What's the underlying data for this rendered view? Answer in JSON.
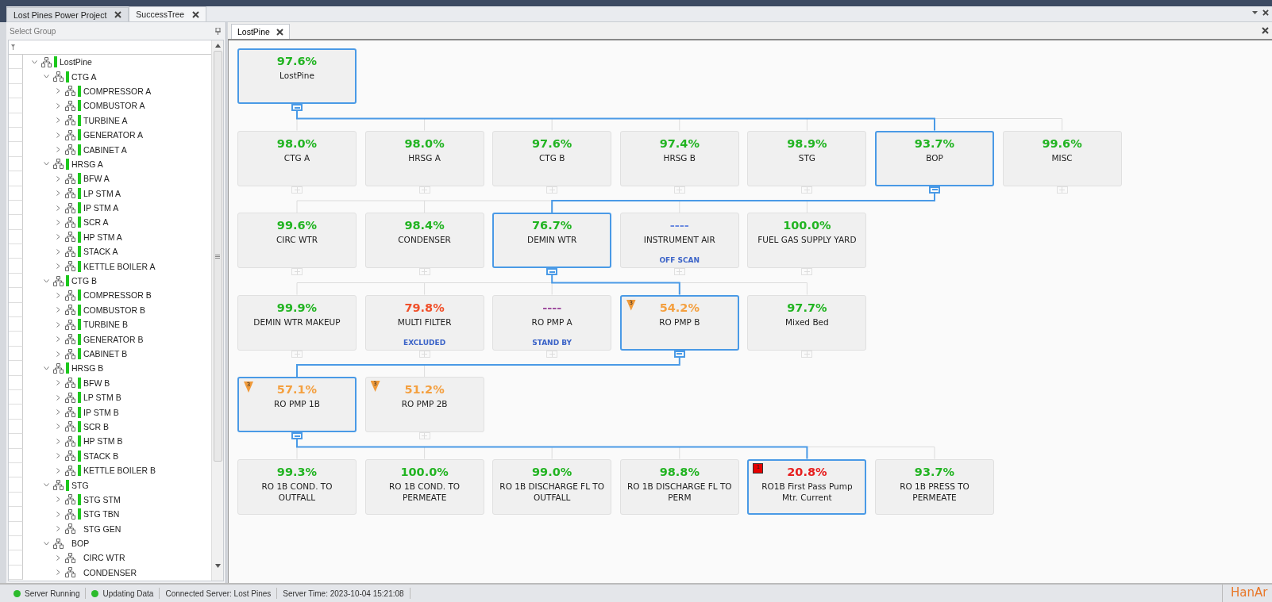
{
  "doc_tabs": [
    {
      "label": "Lost Pines Power Project",
      "selected": false
    },
    {
      "label": "SuccessTree",
      "selected": true
    }
  ],
  "group_panel": {
    "title": "Select Group",
    "items": [
      {
        "name": "LostPine",
        "ok": true,
        "expanded": true,
        "children": [
          {
            "name": "CTG A",
            "ok": true,
            "expanded": true,
            "children": [
              {
                "name": "COMPRESSOR A",
                "ok": true,
                "expanded": false
              },
              {
                "name": "COMBUSTOR A",
                "ok": true,
                "expanded": false
              },
              {
                "name": "TURBINE A",
                "ok": true,
                "expanded": false
              },
              {
                "name": "GENERATOR A",
                "ok": true,
                "expanded": false
              },
              {
                "name": "CABINET A",
                "ok": true,
                "expanded": false
              }
            ]
          },
          {
            "name": "HRSG A",
            "ok": true,
            "expanded": true,
            "children": [
              {
                "name": "BFW A",
                "ok": true,
                "expanded": false
              },
              {
                "name": "LP STM A",
                "ok": true,
                "expanded": false
              },
              {
                "name": "IP STM A",
                "ok": true,
                "expanded": false
              },
              {
                "name": "SCR A",
                "ok": true,
                "expanded": false
              },
              {
                "name": "HP STM A",
                "ok": true,
                "expanded": false
              },
              {
                "name": "STACK A",
                "ok": true,
                "expanded": false
              },
              {
                "name": "KETTLE BOILER A",
                "ok": true,
                "expanded": false
              }
            ]
          },
          {
            "name": "CTG B",
            "ok": true,
            "expanded": true,
            "children": [
              {
                "name": "COMPRESSOR B",
                "ok": true,
                "expanded": false
              },
              {
                "name": "COMBUSTOR B",
                "ok": true,
                "expanded": false
              },
              {
                "name": "TURBINE B",
                "ok": true,
                "expanded": false
              },
              {
                "name": "GENERATOR B",
                "ok": true,
                "expanded": false
              },
              {
                "name": "CABINET B",
                "ok": true,
                "expanded": false
              }
            ]
          },
          {
            "name": "HRSG B",
            "ok": true,
            "expanded": true,
            "children": [
              {
                "name": "BFW B",
                "ok": true,
                "expanded": false
              },
              {
                "name": "LP STM B",
                "ok": true,
                "expanded": false
              },
              {
                "name": "IP STM B",
                "ok": true,
                "expanded": false
              },
              {
                "name": "SCR B",
                "ok": true,
                "expanded": false
              },
              {
                "name": "HP STM B",
                "ok": true,
                "expanded": false
              },
              {
                "name": "STACK B",
                "ok": true,
                "expanded": false
              },
              {
                "name": "KETTLE BOILER B",
                "ok": true,
                "expanded": false
              }
            ]
          },
          {
            "name": "STG",
            "ok": true,
            "expanded": true,
            "children": [
              {
                "name": "STG STM",
                "ok": true,
                "expanded": false
              },
              {
                "name": "STG TBN",
                "ok": true,
                "expanded": false
              },
              {
                "name": "STG GEN",
                "ok": false,
                "expanded": false
              }
            ]
          },
          {
            "name": "BOP",
            "ok": false,
            "expanded": true,
            "children": [
              {
                "name": "CIRC WTR",
                "ok": false,
                "expanded": false
              },
              {
                "name": "CONDENSER",
                "ok": false,
                "expanded": false
              }
            ]
          }
        ]
      }
    ]
  },
  "diagram": {
    "tab": "LostPine",
    "root": {
      "value": "97.6%",
      "color": "#22b422",
      "name": "LostPine",
      "highlighted": true,
      "expanded": true,
      "children": [
        {
          "value": "98.0%",
          "color": "#22b422",
          "name": "CTG A",
          "highlighted": false,
          "expanded": false
        },
        {
          "value": "98.0%",
          "color": "#22b422",
          "name": "HRSG A",
          "highlighted": false,
          "expanded": false
        },
        {
          "value": "97.6%",
          "color": "#22b422",
          "name": "CTG B",
          "highlighted": false,
          "expanded": false
        },
        {
          "value": "97.4%",
          "color": "#22b422",
          "name": "HRSG B",
          "highlighted": false,
          "expanded": false
        },
        {
          "value": "98.9%",
          "color": "#22b422",
          "name": "STG",
          "highlighted": false,
          "expanded": false
        },
        {
          "value": "93.7%",
          "color": "#22b422",
          "name": "BOP",
          "highlighted": true,
          "expanded": true,
          "children": [
            {
              "value": "99.6%",
              "color": "#22b422",
              "name": "CIRC WTR",
              "highlighted": false,
              "expanded": false
            },
            {
              "value": "98.4%",
              "color": "#22b422",
              "name": "CONDENSER",
              "highlighted": false,
              "expanded": false
            },
            {
              "value": "76.7%",
              "color": "#22b422",
              "name": "DEMIN WTR",
              "highlighted": true,
              "expanded": true,
              "children": [
                {
                  "value": "99.9%",
                  "color": "#22b422",
                  "name": "DEMIN WTR MAKEUP",
                  "highlighted": false,
                  "expanded": false
                },
                {
                  "value": "79.8%",
                  "color": "#f0502a",
                  "name": "MULTI FILTER",
                  "status": "EXCLUDED",
                  "highlighted": false,
                  "expanded": false
                },
                {
                  "value": "----",
                  "color": "#a050a0",
                  "name": "RO PMP A",
                  "status": "STAND BY",
                  "highlighted": false,
                  "expanded": false
                },
                {
                  "value": "54.2%",
                  "color": "#f4a040",
                  "name": "RO PMP B",
                  "alarm": {
                    "kind": "warning",
                    "text": "3"
                  },
                  "highlighted": true,
                  "expanded": true,
                  "children": [
                    {
                      "value": "57.1%",
                      "color": "#f4a040",
                      "name": "RO PMP 1B",
                      "alarm": {
                        "kind": "warning",
                        "text": "3"
                      },
                      "highlighted": true,
                      "expanded": true,
                      "children": [
                        {
                          "value": "99.3%",
                          "color": "#22b422",
                          "name": "RO 1B COND. TO OUTFALL",
                          "highlighted": false
                        },
                        {
                          "value": "100.0%",
                          "color": "#22b422",
                          "name": "RO 1B COND. TO PERMEATE",
                          "highlighted": false
                        },
                        {
                          "value": "99.0%",
                          "color": "#22b422",
                          "name": "RO 1B DISCHARGE FL TO OUTFALL",
                          "highlighted": false
                        },
                        {
                          "value": "98.8%",
                          "color": "#22b422",
                          "name": "RO 1B DISCHARGE FL TO PERM",
                          "highlighted": false
                        },
                        {
                          "value": "20.8%",
                          "color": "#e61e1e",
                          "name": "RO1B First Pass Pump Mtr. Current",
                          "alarm": {
                            "kind": "critical",
                            "text": "1"
                          },
                          "highlighted": true
                        },
                        {
                          "value": "93.7%",
                          "color": "#22b422",
                          "name": "RO 1B PRESS TO PERMEATE",
                          "highlighted": false
                        }
                      ]
                    },
                    {
                      "value": "51.2%",
                      "color": "#f4a040",
                      "name": "RO PMP 2B",
                      "alarm": {
                        "kind": "warning",
                        "text": "3"
                      },
                      "highlighted": false,
                      "expanded": false
                    }
                  ]
                },
                {
                  "value": "97.7%",
                  "color": "#22b422",
                  "name": "Mixed Bed",
                  "highlighted": false,
                  "expanded": false
                }
              ]
            },
            {
              "value": "----",
              "color": "#6c8ce0",
              "name": "INSTRUMENT AIR",
              "status": "OFF SCAN",
              "highlighted": false,
              "expanded": false
            },
            {
              "value": "100.0%",
              "color": "#22b422",
              "name": "FUEL GAS SUPPLY YARD",
              "highlighted": false,
              "expanded": false
            }
          ]
        },
        {
          "value": "99.6%",
          "color": "#22b422",
          "name": "MISC",
          "highlighted": false,
          "expanded": false
        }
      ]
    }
  },
  "status_bar": [
    {
      "kind": "indicator",
      "text": "Server Running"
    },
    {
      "kind": "indicator",
      "text": "Updating Data"
    },
    {
      "kind": "text",
      "text": "Connected Server: Lost Pines"
    },
    {
      "kind": "text",
      "text": "Server Time: 2023-10-04 15:21:08"
    }
  ],
  "logo": "HanAr"
}
